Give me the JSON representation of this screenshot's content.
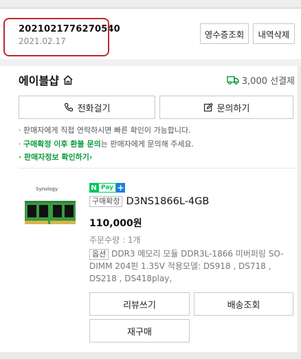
{
  "order": {
    "number": "2021021776270540",
    "date": "2021.02.17",
    "receipt_button": "영수증조회",
    "delete_button": "내역삭제"
  },
  "seller": {
    "name": "에이블샵",
    "home_icon": "home-icon",
    "shipping_fee": "3,000 선결제",
    "shipping_icon": "truck-icon",
    "call_button": "전화걸기",
    "inquiry_button": "문의하기"
  },
  "notices": {
    "line1": "· 판매자에게 직접 연락하시면 빠른 확인이 가능합니다.",
    "line2_prefix": "· ",
    "line2_highlight": "구매확정 이후 환불 문의",
    "line2_suffix": "는 판매자에게 문의해 주세요.",
    "line3_link": "· 판매자정보 확인하기",
    "line3_arrow": "›"
  },
  "product": {
    "brand": "Synology",
    "npay_n": "N",
    "npay_text": "Pay",
    "npay_plus": "+",
    "purchase_tag": "구매확정",
    "name": "D3NS1866L-4GB",
    "price": "110,000원",
    "quantity": "주문수량 : 1개",
    "option_tag": "옵션",
    "option_text": "DDR3 메모리 모듈 DDR3L-1866 미버퍼링 SO-DIMM 204핀 1.35V 적용모델: DS918 , DS718 , DS218 , DS418play,"
  },
  "actions": {
    "review": "리뷰쓰기",
    "tracking": "배송조회",
    "rebuy": "재구매"
  },
  "colors": {
    "highlight": "#c3262b",
    "accent_green": "#0d9b3d",
    "npay_green": "#03c75a",
    "npay_blue": "#1e7ee6"
  }
}
